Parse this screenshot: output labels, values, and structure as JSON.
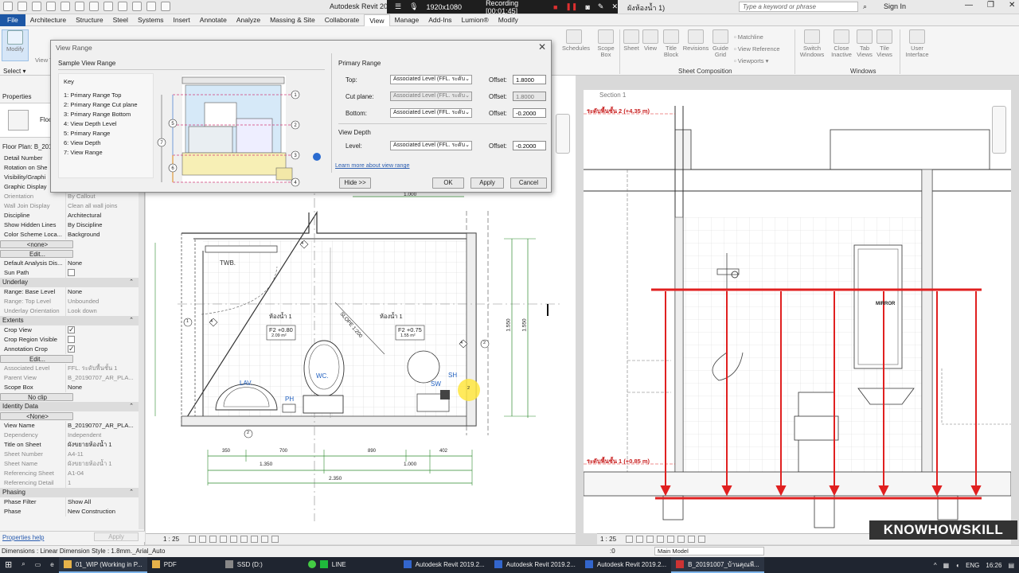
{
  "titlebar": {
    "app_title": "Autodesk Revit 20",
    "recorder": {
      "resolution": "1920x1080",
      "status": "Recording [00:01:45]"
    },
    "doc_title": "ผังห้องน้ำ 1)",
    "search_placeholder": "Type a keyword or phrase",
    "sign_in": "Sign In"
  },
  "tabs": [
    "File",
    "Architecture",
    "Structure",
    "Steel",
    "Systems",
    "Insert",
    "Annotate",
    "Analyze",
    "Massing & Site",
    "Collaborate",
    "View",
    "Manage",
    "Add-Ins",
    "Lumion®",
    "Modify"
  ],
  "active_tab": "View",
  "ribbon": {
    "modify": "Modify",
    "select": "Select",
    "view_temp": "View Temp",
    "sheet_composition": {
      "title": "Sheet Composition",
      "buttons": [
        "Schedules",
        "Scope Box",
        "Sheet",
        "View",
        "Title Block",
        "Revisions",
        "Guide Grid"
      ],
      "small": [
        "Matchline",
        "View Reference",
        "Viewports"
      ]
    },
    "windows": {
      "title": "Windows",
      "buttons": [
        "Switch Windows",
        "Close Inactive",
        "Tab Views",
        "Tile Views"
      ]
    },
    "user_interface": "User Interface"
  },
  "dialog": {
    "title": "View Range",
    "sample_title": "Sample View Range",
    "key_title": "Key",
    "key_items": [
      "1: Primary Range Top",
      "2: Primary Range Cut plane",
      "3: Primary Range Bottom",
      "4: View Depth Level",
      "5: Primary Range",
      "6: View Depth",
      "7: View Range"
    ],
    "primary_range": "Primary Range",
    "rows": [
      {
        "label": "Top:",
        "level": "Associated Level (FFL. ระดับ",
        "offset_label": "Offset:",
        "offset": "1.8000",
        "disabled": false
      },
      {
        "label": "Cut plane:",
        "level": "Associated Level (FFL. ระดับ",
        "offset_label": "Offset:",
        "offset": "1.8000",
        "disabled": true
      },
      {
        "label": "Bottom:",
        "level": "Associated Level (FFL. ระดับ",
        "offset_label": "Offset:",
        "offset": "-0.2000",
        "disabled": false
      }
    ],
    "view_depth": "View Depth",
    "depth_row": {
      "label": "Level:",
      "level": "Associated Level (FFL. ระดับ",
      "offset_label": "Offset:",
      "offset": "-0.2000"
    },
    "learn_link": "Learn more about view range",
    "hide_btn": "Hide >>",
    "ok_btn": "OK",
    "apply_btn": "Apply",
    "cancel_btn": "Cancel"
  },
  "properties": {
    "title": "Properties",
    "type_label": "Floo",
    "selector": "Floor Plan: B_2019",
    "rows_top": [
      {
        "k": "Detail Number",
        "v": ""
      },
      {
        "k": "Rotation on She",
        "v": ""
      },
      {
        "k": "Visibility/Graphi",
        "v": ""
      },
      {
        "k": "Graphic Display",
        "v": ""
      },
      {
        "k": "Orientation",
        "v": "By Callout",
        "grey": true
      },
      {
        "k": "Wall Join Display",
        "v": "Clean all wall joins",
        "grey": true
      },
      {
        "k": "Discipline",
        "v": "Architectural"
      },
      {
        "k": "Show Hidden Lines",
        "v": "By Discipline"
      },
      {
        "k": "Color Scheme Loca...",
        "v": "Background"
      },
      {
        "k": "Color Scheme",
        "v": "<none>",
        "btn": true
      },
      {
        "k": "System Color Sche...",
        "v": "Edit...",
        "btn": true
      },
      {
        "k": "Default Analysis Dis...",
        "v": "None"
      },
      {
        "k": "Sun Path",
        "v": "",
        "chk": false
      }
    ],
    "underlay_title": "Underlay",
    "underlay": [
      {
        "k": "Range: Base Level",
        "v": "None"
      },
      {
        "k": "Range: Top Level",
        "v": "Unbounded",
        "grey": true
      },
      {
        "k": "Underlay Orientation",
        "v": "Look down",
        "grey": true
      }
    ],
    "extents_title": "Extents",
    "extents": [
      {
        "k": "Crop View",
        "v": "",
        "chk": true
      },
      {
        "k": "Crop Region Visible",
        "v": "",
        "chk": false
      },
      {
        "k": "Annotation Crop",
        "v": "",
        "chk": true
      },
      {
        "k": "View Range",
        "v": "Edit...",
        "btn": true
      },
      {
        "k": "Associated Level",
        "v": "FFL. ระดับพื้นชั้น 1",
        "grey": true
      },
      {
        "k": "Parent View",
        "v": "B_20190707_AR_PLA...",
        "grey": true
      },
      {
        "k": "Scope Box",
        "v": "None"
      },
      {
        "k": "Depth Clipping",
        "v": "No clip",
        "btn": true
      }
    ],
    "identity_title": "Identity Data",
    "identity": [
      {
        "k": "View Template",
        "v": "<None>",
        "btn": true
      },
      {
        "k": "View Name",
        "v": "B_20190707_AR_PLA..."
      },
      {
        "k": "Dependency",
        "v": "Independent",
        "grey": true
      },
      {
        "k": "Title on Sheet",
        "v": "ผังขยายห้องน้ำ 1"
      },
      {
        "k": "Sheet Number",
        "v": "A4-11",
        "grey": true
      },
      {
        "k": "Sheet Name",
        "v": "ผังขยายห้องน้ำ 1",
        "grey": true
      },
      {
        "k": "Referencing Sheet",
        "v": "A1-04",
        "grey": true
      },
      {
        "k": "Referencing Detail",
        "v": "1",
        "grey": true
      }
    ],
    "phasing_title": "Phasing",
    "phasing": [
      {
        "k": "Phase Filter",
        "v": "Show All"
      },
      {
        "k": "Phase",
        "v": "New Construction"
      }
    ],
    "help_link": "Properties help",
    "apply": "Apply"
  },
  "plan": {
    "labels": {
      "twb": "TWB.",
      "room_a": "ห้องน้ำ 1",
      "room_b": "ห้องน้ำ 1",
      "tag_a": "F2 +0.80",
      "area_a": "2.09 m²",
      "tag_b": "F2 +0.75",
      "area_b": "1.55 m²",
      "slope": "SLOPE 1:200",
      "wc": "WC.",
      "lav": "LAV.",
      "ph": "PH",
      "sw": "SW",
      "sh": "SH"
    },
    "dims": {
      "top": "1.000",
      "d1": "350",
      "d2": "700",
      "d3": "890",
      "d4": "402",
      "d5": "1.350",
      "d6": "1.000",
      "total": "2.350",
      "right1": "1.550",
      "right2": "1.550"
    },
    "tags": [
      "4",
      "1",
      "4",
      "2",
      "4",
      "2",
      "2"
    ],
    "scale": "1 : 25"
  },
  "section": {
    "tab": "Section 1",
    "level2": "ระดับพื้นชั้น 2 (+4.35 m)",
    "level1": "ระดับพื้นชั้น 1 (+0.85 m)",
    "mirror": "MIRROR",
    "scale": "1 : 25"
  },
  "status": {
    "text": "Dimensions : Linear Dimension Style : 1.8mm._Arial_Auto",
    "zero": ":0",
    "model": "Main Model"
  },
  "taskbar": {
    "apps": [
      "01_WIP (Working in P...",
      "PDF",
      "SSD (D:)",
      "LINE",
      "Autodesk Revit 2019.2...",
      "Autodesk Revit 2019.2...",
      "Autodesk Revit 2019.2...",
      "B_20191007_บ้านคุณพี..."
    ],
    "lang": "ENG",
    "time": "16:26"
  },
  "watermark": "KNOWHOWSKILL",
  "colors": {
    "file_tab": "#1d57a5",
    "section_red": "#e02020",
    "taskbar": "#1f2530",
    "link": "#2a5db0",
    "range_pink": "#d23c7a"
  }
}
